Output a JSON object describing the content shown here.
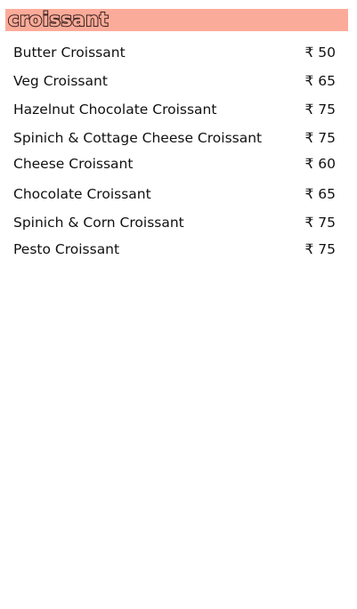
{
  "menu": {
    "section_title": "croissant",
    "colors": {
      "header_background": "#fbab99",
      "title_outline": "#3a2320",
      "text": "#111111"
    },
    "currency_symbol": "₹",
    "items": [
      {
        "name": "Butter Croissant",
        "price": "₹ 50"
      },
      {
        "name": "Veg Croissant",
        "price": "₹ 65"
      },
      {
        "name": "Hazelnut Chocolate Croissant",
        "price": "₹ 75"
      },
      {
        "name": "Spinich & Cottage Cheese Croissant",
        "price": "₹ 75"
      },
      {
        "name": "Cheese Croissant",
        "price": "₹ 60"
      },
      {
        "name": "Chocolate Croissant",
        "price": "₹ 65"
      },
      {
        "name": "Spinich & Corn Croissant",
        "price": "₹ 75"
      },
      {
        "name": "Pesto Croissant",
        "price": "₹ 75"
      }
    ]
  }
}
